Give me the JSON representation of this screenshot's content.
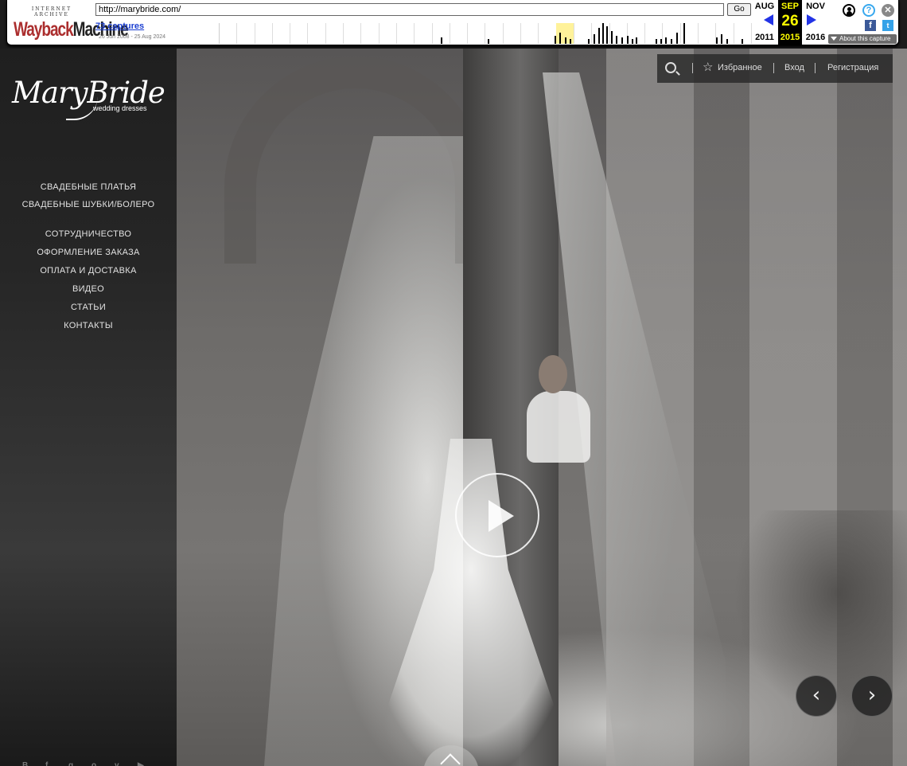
{
  "wayback": {
    "logo_top": "INTERNET ARCHIVE",
    "logo_wm1": "Wayback",
    "logo_wm2": "Machine",
    "url": "http://marybride.com/",
    "go_label": "Go",
    "captures": "73 captures",
    "date_range": "26 Jun 2008 - 25 Aug 2024",
    "prev_month": "AUG",
    "cur_month": "SEP",
    "next_month": "NOV",
    "cur_day": "26",
    "prev_year": "2011",
    "cur_year": "2015",
    "next_year": "2016",
    "about": "About this capture",
    "help_glyph": "?",
    "close_glyph": "✕",
    "fb_glyph": "f",
    "tw_glyph": "t"
  },
  "site": {
    "logo_script": "MaryBride",
    "logo_sub": "wedding dresses",
    "nav_group_1": [
      "СВАДЕБНЫЕ ПЛАТЬЯ",
      "СВАДЕБНЫЕ ШУБКИ/БОЛЕРО"
    ],
    "nav_group_2": [
      "СОТРУДНИЧЕСТВО",
      "ОФОРМЛЕНИЕ ЗАКАЗА",
      "ОПЛАТА И ДОСТАВКА",
      "ВИДЕО",
      "СТАТЬИ",
      "КОНТАКТЫ"
    ],
    "topbar": {
      "favorites": "Избранное",
      "login": "Вход",
      "register": "Регистрация"
    },
    "slide_prev": "‹",
    "slide_next": "›"
  },
  "colors": {
    "wayback_arrow": "#2233e6",
    "wayback_highlight": "#ffff00",
    "nav_text": "#e2e2e2"
  }
}
